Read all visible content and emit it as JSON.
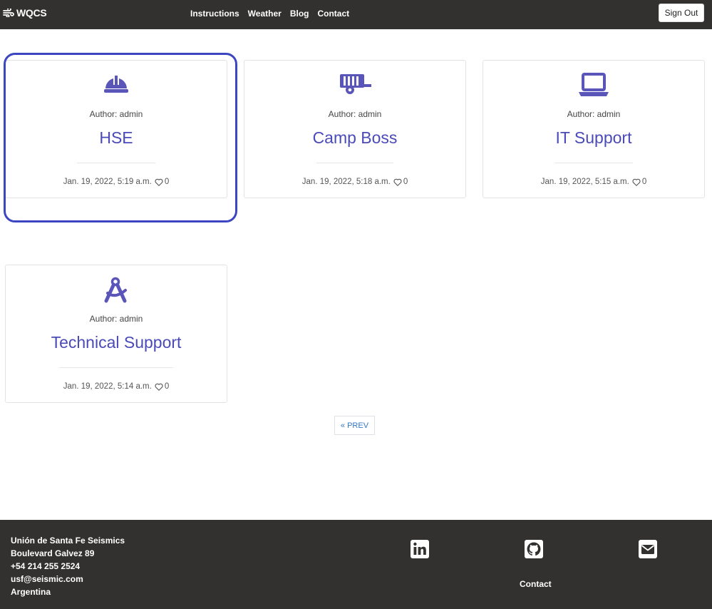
{
  "navbar": {
    "brand": "WQCS",
    "links": [
      "Instructions",
      "Weather",
      "Blog",
      "Contact"
    ],
    "sign_out": "Sign Out"
  },
  "posts": [
    {
      "icon": "hard-hat-icon",
      "author": "Author: admin",
      "title": "HSE",
      "date": "Jan. 19, 2022, 5:19 a.m.",
      "likes": "0"
    },
    {
      "icon": "trailer-icon",
      "author": "Author: admin",
      "title": "Camp Boss",
      "date": "Jan. 19, 2022, 5:18 a.m.",
      "likes": "0"
    },
    {
      "icon": "laptop-icon",
      "author": "Author: admin",
      "title": "IT Support",
      "date": "Jan. 19, 2022, 5:15 a.m.",
      "likes": "0"
    },
    {
      "icon": "compass-drafting-icon",
      "author": "Author: admin",
      "title": "Technical Support",
      "date": "Jan. 19, 2022, 5:14 a.m.",
      "likes": "0"
    }
  ],
  "pagination": {
    "prev": "« PREV"
  },
  "footer": {
    "address": [
      "Unión de Santa Fe Seismics",
      "Boulevard Galvez 89",
      "+54 214 255 2524",
      "usf@seismic.com",
      "Argentina"
    ],
    "social_icons": [
      "linkedin-icon",
      "github-icon",
      "envelope-icon"
    ],
    "contact": "Contact"
  },
  "colors": {
    "navbar_bg": "#323130",
    "accent": "#4a4ab8",
    "icon": "#5a55b8",
    "highlight": "#3c46c0",
    "link": "#3477c9"
  }
}
